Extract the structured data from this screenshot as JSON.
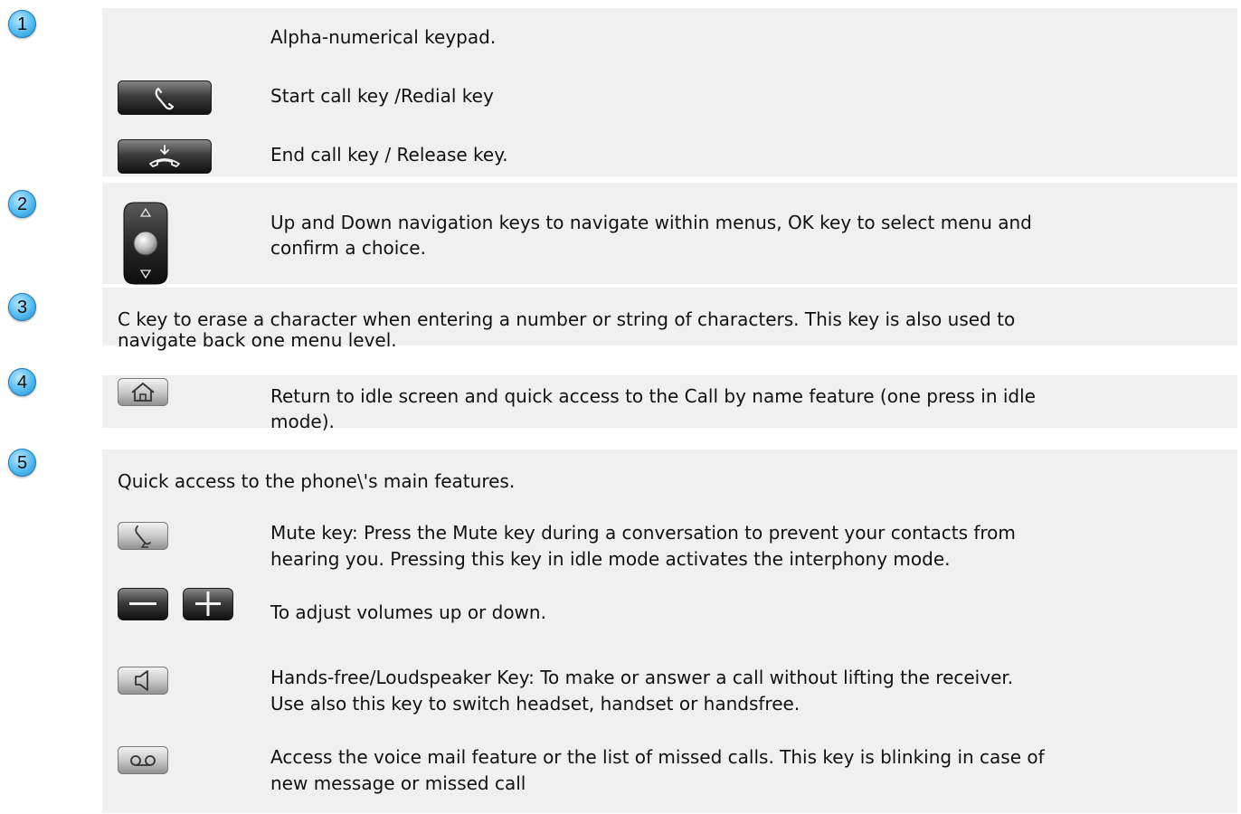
{
  "step_numbers": [
    "1",
    "2",
    "3",
    "4",
    "5"
  ],
  "items": {
    "keypad": "Alpha-numerical keypad.",
    "start_call": "Start call key /Redial key",
    "end_call": "End call key / Release key.",
    "navigation": [
      "Up and Down navigation keys to navigate within menus, OK key to select menu and",
      "confirm a choice."
    ],
    "c_key": [
      "C key to erase a character when entering a number or string of characters. This key is also used to",
      "navigate back one menu level."
    ],
    "home": [
      "Return to idle screen and quick access to the Call by name feature (one press in idle",
      "mode)."
    ],
    "quick_access": "Quick access to the phone\\'s main features.",
    "mute": [
      "Mute key: Press the Mute key during a conversation to prevent your contacts from",
      "hearing you. Pressing this key in idle mode activates the interphony mode."
    ],
    "volume": "To adjust volumes up or down.",
    "handsfree": [
      "Hands-free/Loudspeaker Key: To make or answer a call without lifting the receiver.",
      "Use also this key to switch headset, handset or handsfree."
    ],
    "voicemail": [
      "Access the voice mail feature or the list of missed calls. This key is blinking in case of",
      "new message or missed call"
    ]
  },
  "icons": {
    "start_call": "handset-lifted-icon",
    "end_call": "handset-release-icon",
    "navigation": "navigation-ok-icon",
    "home": "home-icon",
    "mute": "mute-handset-icon",
    "volume_down": "minus-icon",
    "volume_up": "plus-icon",
    "handsfree": "speaker-icon",
    "voicemail": "voicemail-icon"
  },
  "colors": {
    "panel": "#f0f0f0",
    "badge": "#4fb8ef",
    "dark_key": "#2b2b2b"
  }
}
